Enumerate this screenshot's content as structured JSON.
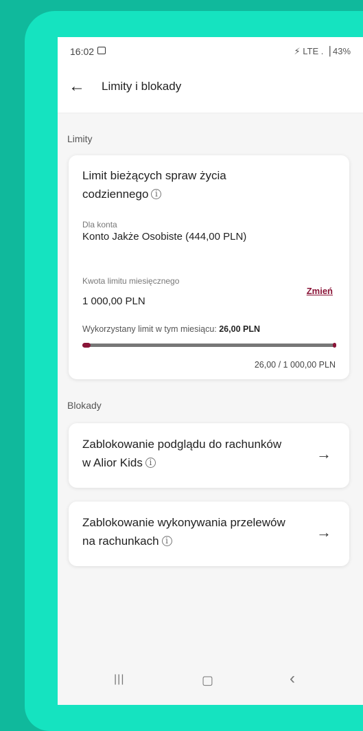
{
  "statusbar": {
    "time": "16:02",
    "right": "⚡ LTE .▕ 43%"
  },
  "appbar": {
    "back": "←",
    "title": "Limity i blokady"
  },
  "sections": {
    "limits": "Limity",
    "blocks": "Blokady"
  },
  "limit_card": {
    "title": "Limit bieżących spraw życia codziennego",
    "info": "i",
    "account_label": "Dla konta",
    "account_value": "Konto Jakże Osobiste (444,00 PLN)",
    "monthly_label": "Kwota limitu miesięcznego",
    "monthly_value": "1 000,00 PLN",
    "change_link": "Zmień",
    "used_label": "Wykorzystany limit w tym miesiącu:",
    "used_value": "26,00 PLN",
    "progress_fraction": 0.026,
    "progress_text": "26,00 / 1 000,00 PLN"
  },
  "block_cards": [
    {
      "title": "Zablokowanie podglądu do rachunków w Alior Kids",
      "info": "i",
      "arrow": "→"
    },
    {
      "title": "Zablokowanie wykonywania przelewów na rachunkach",
      "info": "i",
      "arrow": "→"
    }
  ],
  "navbar": {
    "recent": "|||",
    "home": "▢",
    "back": "‹"
  },
  "colors": {
    "accent": "#8a1538",
    "background": "#10b99c",
    "frame": "#15e3c0",
    "marker": "#f5a623"
  }
}
